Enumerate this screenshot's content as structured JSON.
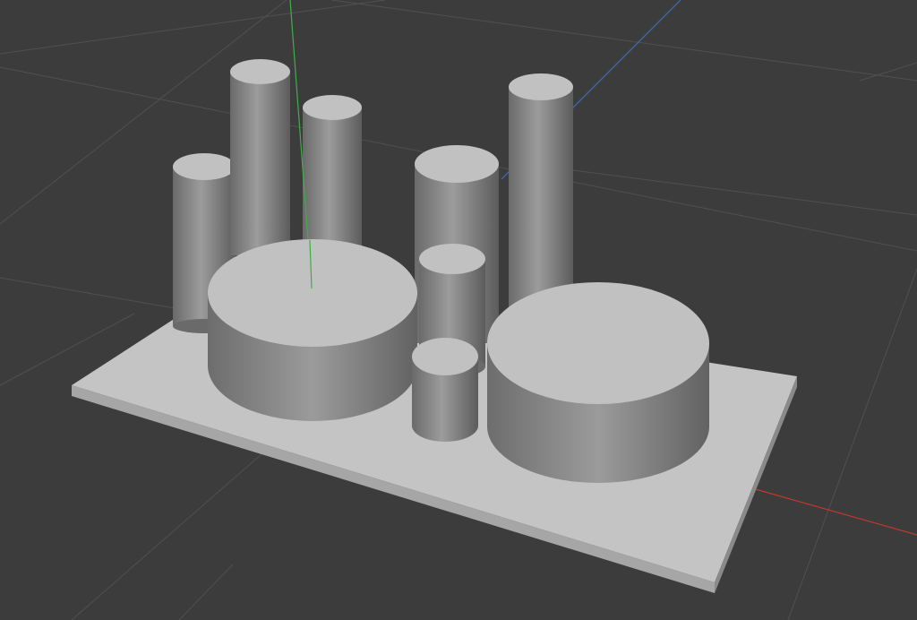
{
  "viewport": {
    "name": "3d-viewport",
    "background_color": "#3c3c3c",
    "grid_color": "#505050",
    "axis_colors": {
      "x": "#c0392b",
      "y": "#3fae49",
      "z": "#3b6fb6"
    }
  },
  "scene": {
    "description_objects": [
      "base-plate",
      "large-cylinder-left",
      "large-cylinder-right",
      "tall-cylinders",
      "short-cylinders"
    ],
    "material_color": "#bdbdbd",
    "side_shading": [
      "#6f6f6f",
      "#9a9a9a",
      "#5f5f5f"
    ]
  }
}
